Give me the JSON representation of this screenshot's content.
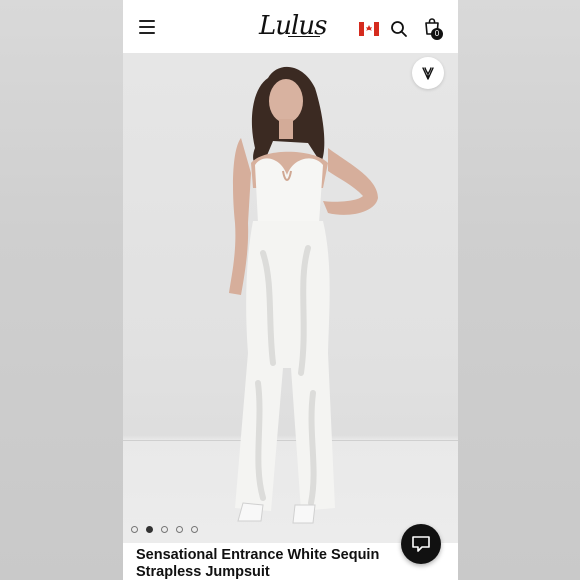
{
  "header": {
    "logo_text": "Lulus",
    "country": "Canada",
    "cart_count": "0"
  },
  "icons": [
    "menu-icon",
    "canada-flag-icon",
    "search-icon",
    "shopping-bag-icon",
    "heart-icon",
    "chat-icon"
  ],
  "carousel": {
    "total_slides": 5,
    "active_slide": 2
  },
  "product": {
    "title_line1": "Sensational Entrance White Sequin",
    "title_line2": "Strapless Jumpsuit"
  },
  "colors": {
    "header_bg": "#ffffff",
    "hero_bg": "#e3e3e3",
    "text": "#111111",
    "chat_button": "#111111"
  }
}
